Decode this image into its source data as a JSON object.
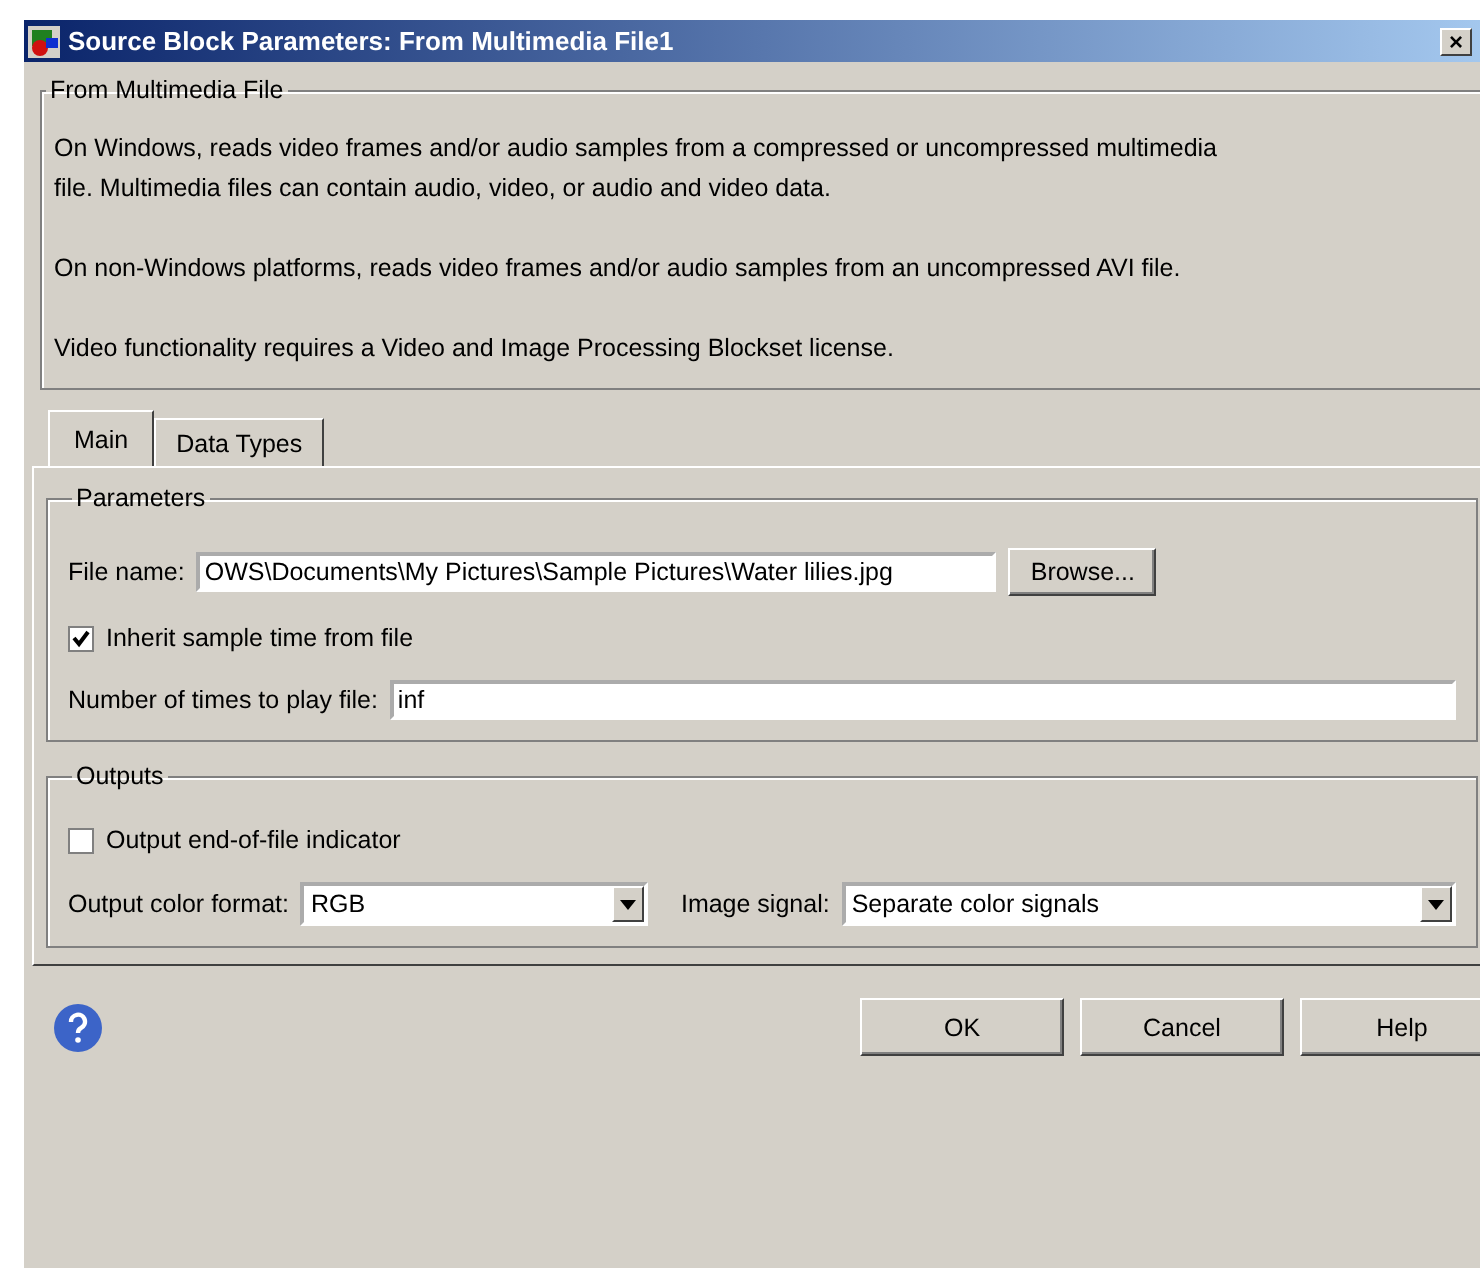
{
  "window": {
    "title": "Source Block Parameters: From Multimedia File1",
    "close": "×"
  },
  "description": {
    "title": "From Multimedia File",
    "paragraphs": [
      "On Windows, reads video frames and/or audio samples from a compressed or uncompressed multimedia file. Multimedia files can contain audio, video, or audio and video data.",
      "On non-Windows platforms, reads video frames and/or audio samples from an uncompressed AVI file.",
      "Video functionality requires a Video and Image Processing Blockset license."
    ]
  },
  "tabs": [
    {
      "label": "Main",
      "selected": true
    },
    {
      "label": "Data Types",
      "selected": false
    }
  ],
  "parameters": {
    "title": "Parameters",
    "file_name": {
      "label": "File name:",
      "value": "OWS\\Documents\\My Pictures\\Sample Pictures\\Water lilies.jpg"
    },
    "browse": "Browse...",
    "inherit": {
      "label": "Inherit sample time from file",
      "checked": true
    },
    "times": {
      "label": "Number of times to play file:",
      "value": "inf"
    }
  },
  "outputs": {
    "title": "Outputs",
    "eof": {
      "label": "Output end-of-file indicator",
      "checked": false
    },
    "color_format": {
      "label": "Output color format:",
      "value": "RGB"
    },
    "image_signal": {
      "label": "Image signal:",
      "value": "Separate color signals"
    }
  },
  "buttons": [
    "OK",
    "Cancel",
    "Help"
  ]
}
